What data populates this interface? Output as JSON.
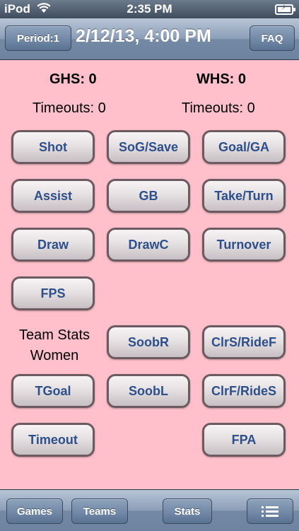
{
  "status_bar": {
    "carrier": "iPod",
    "time": "2:35 PM",
    "wifi_icon": "wifi-icon",
    "battery_icon": "battery-charging-icon"
  },
  "nav": {
    "period_label": "Period:1",
    "title": "2/12/13, 4:00 PM",
    "faq_label": "FAQ"
  },
  "score": {
    "home": "GHS: 0",
    "away": "WHS: 0",
    "home_timeouts": "Timeouts: 0",
    "away_timeouts": "Timeouts: 0"
  },
  "team_stats_label": {
    "line1": "Team Stats",
    "line2": "Women"
  },
  "stat_buttons": {
    "shot": "Shot",
    "sog_save": "SoG/Save",
    "goal_ga": "Goal/GA",
    "assist": "Assist",
    "gb": "GB",
    "take_turn": "Take/Turn",
    "draw": "Draw",
    "drawc": "DrawC",
    "turnover": "Turnover",
    "fps": "FPS",
    "soobr": "SoobR",
    "clrs_ridef": "ClrS/RideF",
    "tgoal": "TGoal",
    "soobl": "SoobL",
    "clrf_rides": "ClrF/RideS",
    "timeout": "Timeout",
    "fpa": "FPA"
  },
  "toolbar": {
    "games": "Games",
    "teams": "Teams",
    "stats": "Stats",
    "menu_icon": "list-menu-icon"
  },
  "colors": {
    "background": "#ffc0cb",
    "button_text": "#2d4f8a",
    "bar": "#7489a4"
  }
}
